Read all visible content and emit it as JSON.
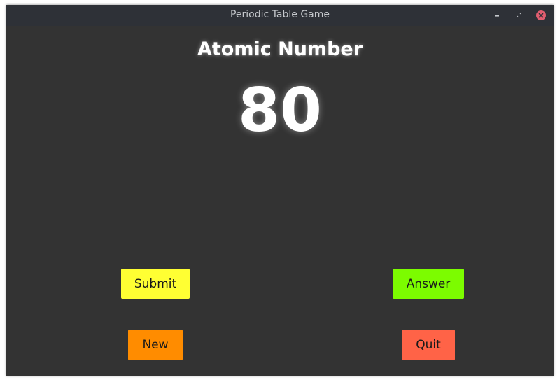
{
  "window": {
    "title": "Periodic Table Game"
  },
  "main": {
    "heading": "Atomic Number",
    "number": "80",
    "answer_input": {
      "value": "",
      "placeholder": ""
    }
  },
  "buttons": {
    "submit": "Submit",
    "answer": "Answer",
    "new": "New",
    "quit": "Quit"
  },
  "icons": {
    "minimize": "minimize-icon",
    "maximize": "maximize-icon",
    "close": "close-icon"
  },
  "colors": {
    "background": "#333333",
    "titlebar": "#2e3137",
    "input_underline": "#1ba9d6",
    "submit": "#ffff33",
    "answer": "#7cfc00",
    "new": "#ff8c00",
    "quit": "#ff6347",
    "close_button": "#e05d6f"
  }
}
